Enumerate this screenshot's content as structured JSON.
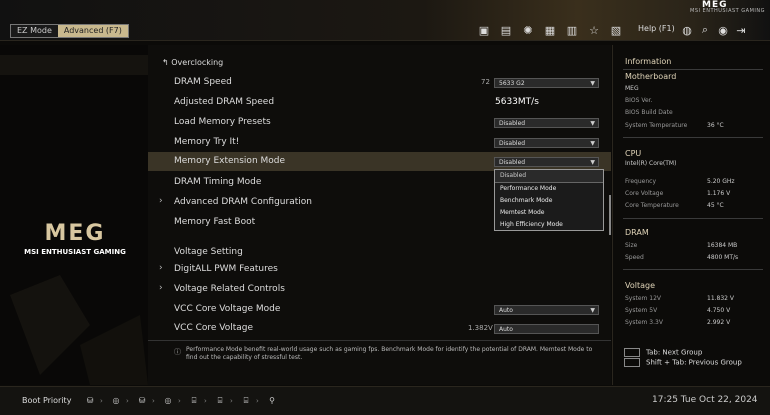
{
  "topbar": {
    "modes": [
      "EZ Mode",
      "Advanced (F7)"
    ],
    "help_label": "Help (F1)",
    "top_icons": [
      "cpu-icon",
      "memory-icon",
      "fan-icon",
      "board-icon",
      "m-flash-icon",
      "favorite-icon",
      "hardware-monitor-icon"
    ],
    "right_icons": [
      "globe-icon",
      "search-icon",
      "camera-icon",
      "exit-icon"
    ],
    "logo": "MEG",
    "logo_sub": "MSI ENTHUSIAST GAMING"
  },
  "brand": {
    "mark": "MEG",
    "text": "MSI ENTHUSIAST GAMING"
  },
  "main": {
    "section_title": "Overclocking",
    "rows": [
      {
        "label": "DRAM Speed",
        "num": "72",
        "dropdown": "5633 G2"
      },
      {
        "label": "Adjusted DRAM Speed",
        "value": "5633MT/s"
      },
      {
        "label": "Load Memory Presets",
        "dropdown": "Disabled"
      },
      {
        "label": "Memory Try It!",
        "dropdown": "Disabled"
      },
      {
        "label": "Memory Extension Mode",
        "dropdown": "Disabled"
      },
      {
        "label": "DRAM Timing Mode"
      },
      {
        "label": "Advanced DRAM Configuration"
      },
      {
        "label": "Memory Fast Boot"
      },
      {
        "label": "Voltage Setting"
      },
      {
        "label": "DigitALL PWM Features"
      },
      {
        "label": "Voltage Related Controls"
      },
      {
        "label": "VCC Core Voltage Mode",
        "dropdown": "Auto"
      },
      {
        "label": "VCC Core Voltage",
        "num": "1.382V",
        "dropdown": "Auto"
      }
    ],
    "dropdown_options": [
      "Disabled",
      "Performance Mode",
      "Benchmark Mode",
      "Memtest Mode",
      "High Efficiency Mode"
    ],
    "help_text": "Performance Mode benefit real-world usage such as gaming fps. Benchmark Mode for identify the potential of DRAM. Memtest Mode to find out the capability of stressful test."
  },
  "info": {
    "title": "Information",
    "motherboard": {
      "title": "Motherboard",
      "name": "MEG",
      "bios_ver": "BIOS Ver.",
      "bios_date": "BIOS Build Date",
      "sys_temp_label": "System Temperature",
      "sys_temp": "36 °C"
    },
    "cpu": {
      "title": "CPU",
      "name": "Intel(R) Core(TM)",
      "freq_label": "Frequency",
      "freq": "5.20 GHz",
      "volt_label": "Core Voltage",
      "volt": "1.176 V",
      "temp_label": "Core Temperature",
      "temp": "45 °C"
    },
    "dram": {
      "title": "DRAM",
      "size_label": "Size",
      "size": "16384 MB",
      "speed_label": "Speed",
      "speed": "4800 MT/s"
    },
    "voltage": {
      "title": "Voltage",
      "v12_label": "System 12V",
      "v12": "11.832 V",
      "v5_label": "System 5V",
      "v5": "4.750 V",
      "v33_label": "System 3.3V",
      "v33": "2.992 V"
    },
    "keys": {
      "tab": "Tab: Next Group",
      "shift_tab": "Shift + Tab: Previous Group"
    }
  },
  "bottom": {
    "boot_priority": "Boot Priority",
    "clock": "17:25  Tue Oct 22, 2024"
  }
}
